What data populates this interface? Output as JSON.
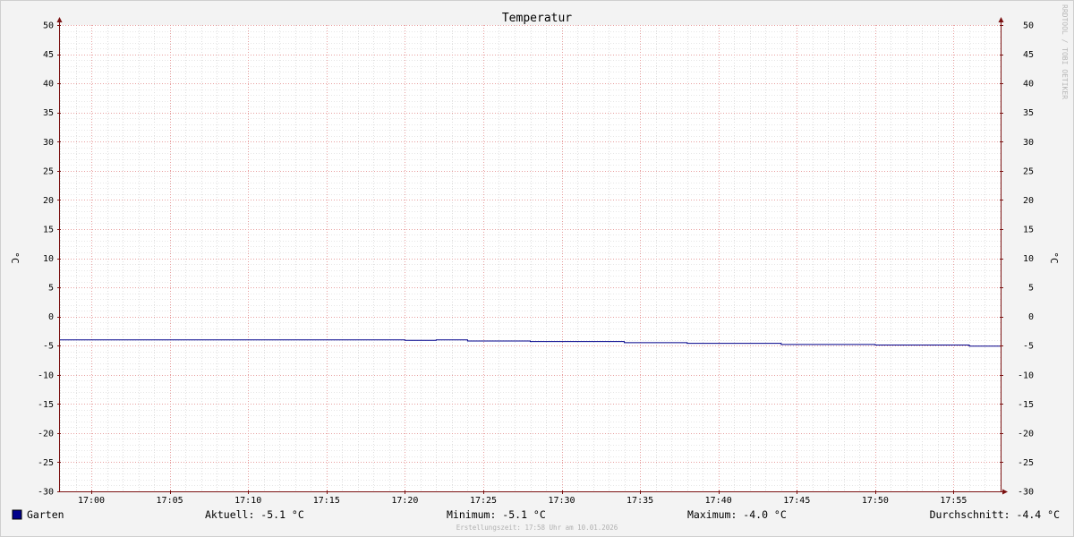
{
  "chart_data": {
    "type": "line",
    "title": "Temperatur",
    "ylabel": "°C",
    "ylabel_right": "°C",
    "watermark": "RRDTOOL / TOBI OETIKER",
    "ylim": [
      -30,
      50
    ],
    "y_ticks": [
      50,
      45,
      40,
      35,
      30,
      25,
      20,
      15,
      10,
      5,
      0,
      -5,
      -10,
      -15,
      -20,
      -25,
      -30
    ],
    "xlim": [
      "16:58",
      "17:58"
    ],
    "x_ticks": [
      "17:00",
      "17:05",
      "17:10",
      "17:15",
      "17:20",
      "17:25",
      "17:30",
      "17:35",
      "17:40",
      "17:45",
      "17:50",
      "17:55"
    ],
    "grid": true,
    "series": [
      {
        "name": "Garten",
        "color": "#00008b",
        "x": [
          "16:58",
          "17:20",
          "17:22",
          "17:24",
          "17:26",
          "17:28",
          "17:30",
          "17:32",
          "17:34",
          "17:36",
          "17:38",
          "17:40",
          "17:42",
          "17:44",
          "17:46",
          "17:48",
          "17:50",
          "17:52",
          "17:54",
          "17:56",
          "17:58"
        ],
        "values": [
          -4.0,
          -4.1,
          -4.0,
          -4.2,
          -4.2,
          -4.3,
          -4.3,
          -4.3,
          -4.5,
          -4.5,
          -4.6,
          -4.6,
          -4.6,
          -4.8,
          -4.8,
          -4.8,
          -4.9,
          -4.9,
          -4.9,
          -5.1,
          -5.1
        ]
      }
    ],
    "legend": {
      "series_label": "Garten",
      "stats": [
        "Aktuell: -5.1 °C",
        "Minimum: -5.1 °C",
        "Maximum: -4.0 °C",
        "Durchschnitt: -4.4 °C"
      ]
    },
    "footer": "Erstellungszeit: 17:58 Uhr am 10.01.2026"
  }
}
